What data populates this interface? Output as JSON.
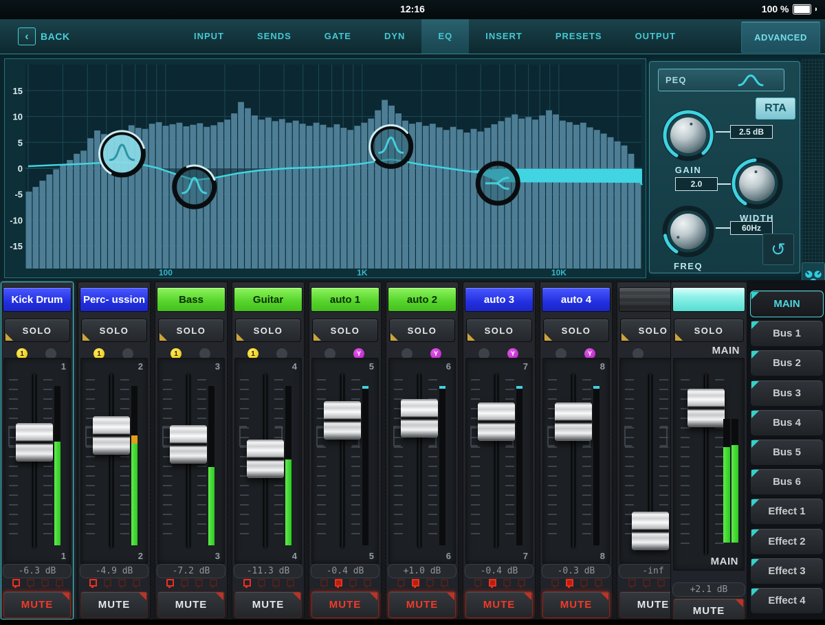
{
  "status_bar": {
    "time": "12:16",
    "battery_label": "100 %"
  },
  "nav": {
    "back_label": "BACK",
    "tabs": [
      {
        "label": "INPUT",
        "active": false
      },
      {
        "label": "SENDS",
        "active": false
      },
      {
        "label": "GATE",
        "active": false
      },
      {
        "label": "DYN",
        "active": false
      },
      {
        "label": "EQ",
        "active": true
      },
      {
        "label": "INSERT",
        "active": false
      },
      {
        "label": "PRESETS",
        "active": false
      },
      {
        "label": "OUTPUT",
        "active": false
      }
    ],
    "advanced_label": "ADVANCED"
  },
  "eq": {
    "panel": {
      "type_selector": "PEQ",
      "rta_label": "RTA",
      "gain": {
        "label": "GAIN",
        "value": "2.5 dB"
      },
      "width": {
        "label": "WIDTH",
        "value": "2.0"
      },
      "freq": {
        "label": "FREQ",
        "value": "60Hz"
      }
    },
    "chart_data": {
      "type": "area",
      "x_axis": {
        "scale": "log",
        "unit": "Hz",
        "tick_labels": [
          "100",
          "1K",
          "10K"
        ],
        "tick_values": [
          100,
          1000,
          10000
        ],
        "range": [
          20,
          27000
        ]
      },
      "y_axis": {
        "unit": "dB",
        "tick_labels": [
          "15",
          "10",
          "5",
          "0",
          "-5",
          "-10",
          "-15"
        ],
        "tick_values": [
          15,
          10,
          5,
          0,
          -5,
          -10,
          -15
        ],
        "range": [
          -19.5,
          19.5
        ]
      },
      "grid": true,
      "colors": {
        "bars": "#4d7e95",
        "curve": "#41d4e2",
        "grid": "#1d4a56",
        "plot_bg": "#0b2731"
      },
      "rta_spectrum_db": [
        -4.5,
        -3.6,
        -2.4,
        -1.2,
        -0.2,
        0.6,
        1.6,
        2.8,
        3.4,
        5.8,
        7.3,
        6.6,
        6.2,
        6.8,
        7.1,
        8.3,
        7.8,
        7.6,
        8.6,
        8.9,
        8.2,
        8.5,
        8.8,
        8.1,
        8.4,
        8.7,
        8.0,
        8.3,
        8.9,
        9.4,
        10.6,
        12.8,
        11.6,
        10.2,
        9.4,
        9.8,
        9.1,
        9.5,
        8.8,
        9.2,
        8.6,
        8.2,
        8.8,
        8.4,
        7.9,
        8.5,
        7.8,
        7.4,
        8.2,
        8.8,
        9.6,
        11.2,
        13.2,
        12.1,
        10.6,
        9.2,
        8.6,
        8.9,
        8.2,
        8.6,
        7.9,
        7.4,
        8.0,
        7.5,
        6.9,
        7.6,
        7.1,
        7.8,
        8.5,
        9.1,
        9.8,
        10.4,
        9.6,
        9.9,
        9.4,
        10.2,
        11.2,
        10.4,
        9.2,
        8.9,
        8.4,
        8.8,
        7.9,
        7.4,
        6.7,
        6.0,
        5.2,
        4.4,
        2.8,
        -1.3
      ],
      "eq_curve": [
        [
          20,
          0.4
        ],
        [
          40,
          0.9
        ],
        [
          55,
          1.2
        ],
        [
          70,
          1.0
        ],
        [
          90,
          0.1
        ],
        [
          110,
          -1.0
        ],
        [
          140,
          -2.3
        ],
        [
          180,
          -1.8
        ],
        [
          230,
          -1.0
        ],
        [
          300,
          -0.4
        ],
        [
          420,
          0.0
        ],
        [
          600,
          0.2
        ],
        [
          800,
          0.5
        ],
        [
          1000,
          0.9
        ],
        [
          1250,
          1.5
        ],
        [
          1400,
          1.7
        ],
        [
          1600,
          1.4
        ],
        [
          2000,
          0.7
        ],
        [
          2600,
          0.1
        ],
        [
          3200,
          -0.4
        ],
        [
          4000,
          -0.9
        ],
        [
          5000,
          -1.3
        ],
        [
          7000,
          -1.5
        ],
        [
          10000,
          -1.4
        ],
        [
          15000,
          -1.3
        ],
        [
          21000,
          -1.2
        ],
        [
          24500,
          -1.4
        ],
        [
          26500,
          -3.2
        ]
      ],
      "shelf_band": {
        "from_hz": 3600,
        "to_hz": 26500,
        "top_db": -0.1,
        "bottom_db": -2.8
      },
      "handles": [
        {
          "band": 1,
          "shape": "bell",
          "freq_hz": 60,
          "gain_db": 2.8,
          "selected": true
        },
        {
          "band": 2,
          "shape": "bell",
          "freq_hz": 140,
          "gain_db": -3.6,
          "selected": false
        },
        {
          "band": 3,
          "shape": "bell",
          "freq_hz": 1400,
          "gain_db": 4.2,
          "selected": false
        },
        {
          "band": 4,
          "shape": "shelf",
          "freq_hz": 4900,
          "gain_db": -2.9,
          "selected": false
        }
      ]
    }
  },
  "channels": [
    {
      "name": "Kick Drum",
      "color": "blue",
      "number": "1",
      "solo_label": "SOLO",
      "db": "-6.3 dB",
      "mute_label": "MUTE",
      "muted": true,
      "selected": true,
      "badges": {
        "left": {
          "text": "1",
          "color": "yellow"
        },
        "right": {
          "text": "",
          "color": "gray"
        }
      },
      "fader_pos": 0.32,
      "meter": {
        "level": 0.65,
        "peak": null
      },
      "groups": [
        "hot",
        "dim",
        "dim",
        "dim"
      ]
    },
    {
      "name": "Perc- ussion",
      "color": "blue",
      "number": "2",
      "solo_label": "SOLO",
      "db": "-4.9 dB",
      "mute_label": "MUTE",
      "muted": false,
      "selected": false,
      "badges": {
        "left": {
          "text": "1",
          "color": "yellow"
        },
        "right": {
          "text": "",
          "color": "gray"
        }
      },
      "fader_pos": 0.27,
      "meter": {
        "level": 0.64,
        "peak": "orange"
      },
      "groups": [
        "hot",
        "dim",
        "dim",
        "dim"
      ]
    },
    {
      "name": "Bass",
      "color": "green",
      "number": "3",
      "solo_label": "SOLO",
      "db": "-7.2 dB",
      "mute_label": "MUTE",
      "muted": false,
      "selected": false,
      "badges": {
        "left": {
          "text": "1",
          "color": "yellow"
        },
        "right": {
          "text": "",
          "color": "gray"
        }
      },
      "fader_pos": 0.335,
      "meter": {
        "level": 0.49,
        "peak": null
      },
      "groups": [
        "hot",
        "dim",
        "dim",
        "dim"
      ]
    },
    {
      "name": "Guitar",
      "color": "green",
      "number": "4",
      "solo_label": "SOLO",
      "db": "-11.3 dB",
      "mute_label": "MUTE",
      "muted": false,
      "selected": false,
      "badges": {
        "left": {
          "text": "1",
          "color": "yellow"
        },
        "right": {
          "text": "",
          "color": "gray"
        }
      },
      "fader_pos": 0.44,
      "meter": {
        "level": 0.54,
        "peak": null
      },
      "groups": [
        "hot",
        "dim",
        "dim",
        "dim"
      ]
    },
    {
      "name": "auto 1",
      "color": "green",
      "number": "5",
      "solo_label": "SOLO",
      "db": "-0.4 dB",
      "mute_label": "MUTE",
      "muted": true,
      "selected": false,
      "badges": {
        "left": {
          "text": "",
          "color": "gray"
        },
        "right": {
          "text": "Y",
          "color": "magenta"
        }
      },
      "fader_pos": 0.16,
      "meter": {
        "level": 0,
        "peak": "cyan"
      },
      "groups": [
        "dim",
        "lit",
        "dim",
        "dim"
      ]
    },
    {
      "name": "auto 2",
      "color": "green",
      "number": "6",
      "solo_label": "SOLO",
      "db": "+1.0 dB",
      "mute_label": "MUTE",
      "muted": true,
      "selected": false,
      "badges": {
        "left": {
          "text": "",
          "color": "gray"
        },
        "right": {
          "text": "Y",
          "color": "magenta"
        }
      },
      "fader_pos": 0.145,
      "meter": {
        "level": 0,
        "peak": "cyan"
      },
      "groups": [
        "dim",
        "lit",
        "dim",
        "dim"
      ]
    },
    {
      "name": "auto 3",
      "color": "blue",
      "number": "7",
      "solo_label": "SOLO",
      "db": "-0.4 dB",
      "mute_label": "MUTE",
      "muted": true,
      "selected": false,
      "badges": {
        "left": {
          "text": "",
          "color": "gray"
        },
        "right": {
          "text": "Y",
          "color": "magenta"
        }
      },
      "fader_pos": 0.17,
      "meter": {
        "level": 0,
        "peak": "cyan"
      },
      "groups": [
        "dim",
        "lit",
        "dim",
        "dim"
      ]
    },
    {
      "name": "auto 4",
      "color": "blue",
      "number": "8",
      "solo_label": "SOLO",
      "db": "-0.3 dB",
      "mute_label": "MUTE",
      "muted": true,
      "selected": false,
      "badges": {
        "left": {
          "text": "",
          "color": "gray"
        },
        "right": {
          "text": "Y",
          "color": "magenta"
        }
      },
      "fader_pos": 0.17,
      "meter": {
        "level": 0,
        "peak": "cyan"
      },
      "groups": [
        "dim",
        "lit",
        "dim",
        "dim"
      ]
    },
    {
      "name": "",
      "color": "gray",
      "number": "",
      "solo_label": "SOLO",
      "db": "-inf",
      "mute_label": "MUTE",
      "muted": false,
      "selected": false,
      "badges": {
        "left": {
          "text": "",
          "color": "gray"
        },
        "right": null
      },
      "fader_pos": 0.965,
      "meter": {
        "level": 0,
        "peak": null
      },
      "groups": [
        "dim",
        "dim",
        "dim",
        "dim"
      ]
    }
  ],
  "main_strip": {
    "solo_label": "SOLO",
    "name_top": "MAIN",
    "name_bottom": "MAIN",
    "db": "+2.1 dB",
    "mute_label": "MUTE",
    "muted": false,
    "fader_pos": 0.067,
    "meter": {
      "level_l": 0.77,
      "level_r": 0.79,
      "stereo": true
    }
  },
  "sidebar": {
    "buttons": [
      {
        "label": "MAIN",
        "active": true
      },
      {
        "label": "Bus 1",
        "active": false
      },
      {
        "label": "Bus 2",
        "active": false
      },
      {
        "label": "Bus 3",
        "active": false
      },
      {
        "label": "Bus 4",
        "active": false
      },
      {
        "label": "Bus 5",
        "active": false
      },
      {
        "label": "Bus 6",
        "active": false
      },
      {
        "label": "Effect 1",
        "active": false
      },
      {
        "label": "Effect 2",
        "active": false
      },
      {
        "label": "Effect 3",
        "active": false
      },
      {
        "label": "Effect 4",
        "active": false
      }
    ]
  }
}
